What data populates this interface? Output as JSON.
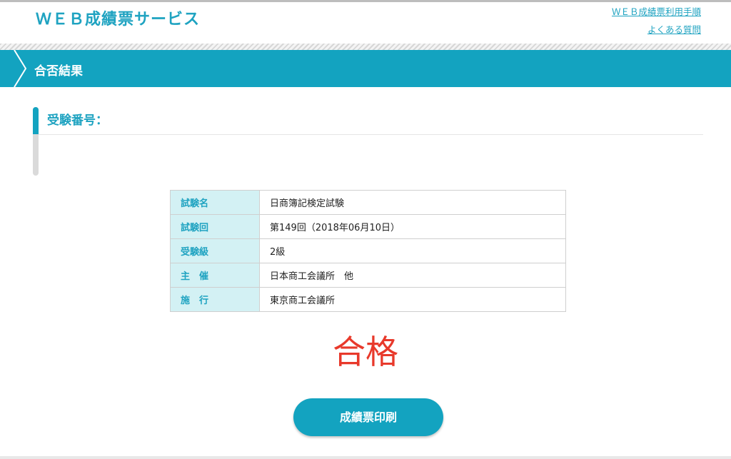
{
  "header": {
    "site_title": "ＷＥＢ成績票サービス",
    "links": [
      "ＷＥＢ成績票利用手順",
      "よくある質問"
    ]
  },
  "banner": {
    "title": "合否結果"
  },
  "section": {
    "heading": "受験番号："
  },
  "exam_info": [
    {
      "label": "試験名",
      "value": "日商簿記検定試験"
    },
    {
      "label": "試験回",
      "value": "第149回（2018年06月10日）"
    },
    {
      "label": "受験級",
      "value": "2級"
    },
    {
      "label": "主　催",
      "value": "日本商工会議所　他"
    },
    {
      "label": "施　行",
      "value": "東京商工会議所"
    }
  ],
  "result": "合格",
  "print_button": "成績票印刷",
  "colors": {
    "accent": "#13a3c0",
    "pass": "#e8392b",
    "label_bg": "#d3f1f4"
  }
}
